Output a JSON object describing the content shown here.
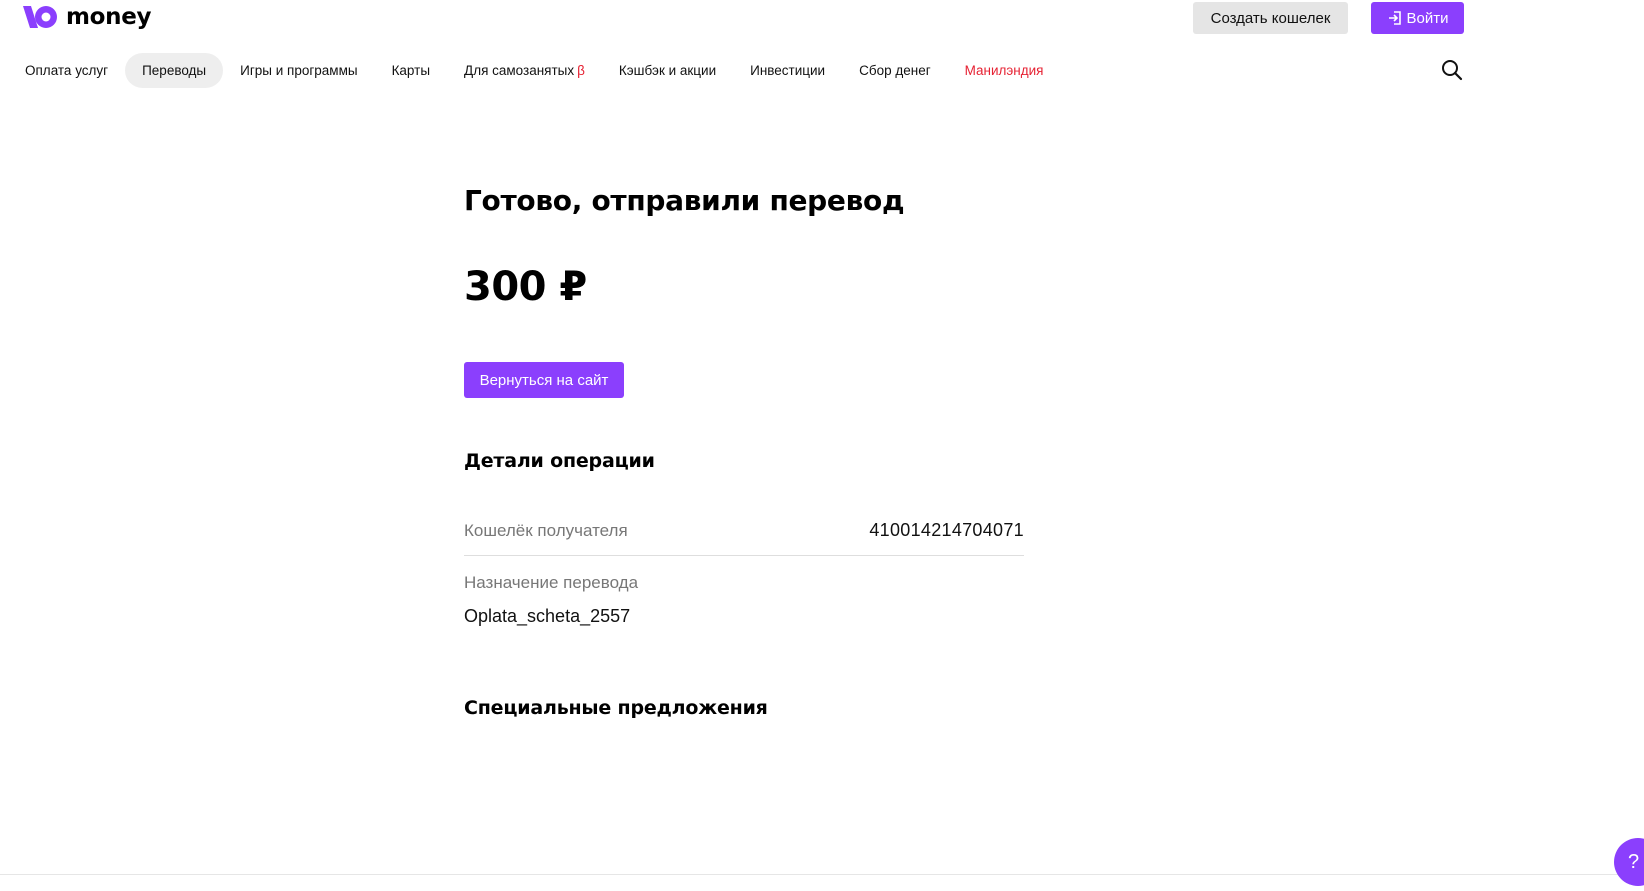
{
  "header": {
    "logo_text": "money",
    "create_wallet_label": "Создать кошелек",
    "login_label": "Войти"
  },
  "nav": {
    "items": [
      {
        "label": "Оплата услуг"
      },
      {
        "label": "Переводы",
        "active": true
      },
      {
        "label": "Игры и программы"
      },
      {
        "label": "Карты"
      },
      {
        "label": "Для самозанятых",
        "badge": "β"
      },
      {
        "label": "Кэшбэк и акции"
      },
      {
        "label": "Инвестиции"
      },
      {
        "label": "Сбор денег"
      },
      {
        "label": "Манилэндия",
        "highlight": true
      }
    ]
  },
  "main": {
    "title": "Готово, отправили перевод",
    "amount": "300 ₽",
    "back_button_label": "Вернуться на сайт",
    "details_title": "Детали операции",
    "recipient_wallet_label": "Кошелёк получателя",
    "recipient_wallet_value": "410014214704071",
    "purpose_label": "Назначение перевода",
    "purpose_value": "Oplata_scheta_2557",
    "offers_title": "Специальные предложения"
  },
  "help": {
    "label": "?"
  },
  "colors": {
    "brand": "#8b3ffd",
    "highlight": "#e62233",
    "muted_text": "#777777"
  }
}
